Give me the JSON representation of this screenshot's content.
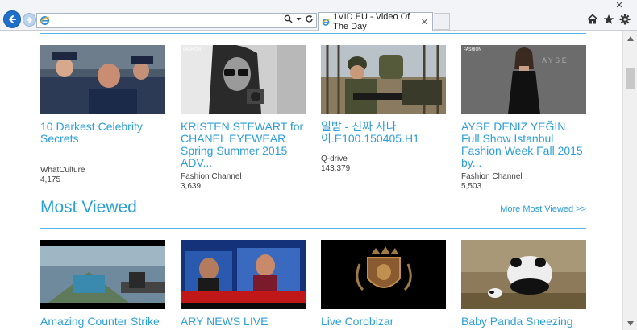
{
  "browser": {
    "address_value": "",
    "tab_title": "1VID.EU - Video Of The Day",
    "close_glyph": "✕"
  },
  "top_row": [
    {
      "title": "10 Darkest Celebrity Secrets",
      "channel": "WhatCulture",
      "views": "4,175"
    },
    {
      "title": "KRISTEN STEWART for CHANEL EYEWEAR Spring Summer 2015 ADV...",
      "channel": "Fashion Channel",
      "views": "3,639",
      "thumb_label": "FASHION"
    },
    {
      "title": "일밤 - 진짜 사나이.E100.150405.H1",
      "channel": "Q-drive",
      "views": "143,379"
    },
    {
      "title": "AYSE DENIZ YEĞIN Full Show Istanbul Fashion Week Fall 2015 by...",
      "channel": "Fashion Channel",
      "views": "5,503",
      "thumb_label": "FASHION"
    }
  ],
  "most_viewed": {
    "heading": "Most Viewed",
    "more_link": "More Most Viewed >>",
    "items": [
      {
        "title": "Amazing Counter Strike"
      },
      {
        "title": "ARY NEWS LIVE"
      },
      {
        "title": "Live Corobizar"
      },
      {
        "title": "Baby Panda Sneezing"
      }
    ]
  },
  "colors": {
    "accent": "#2b9fd9",
    "rule": "#5ab4e5",
    "ie_blue": "#1e6fc9"
  }
}
